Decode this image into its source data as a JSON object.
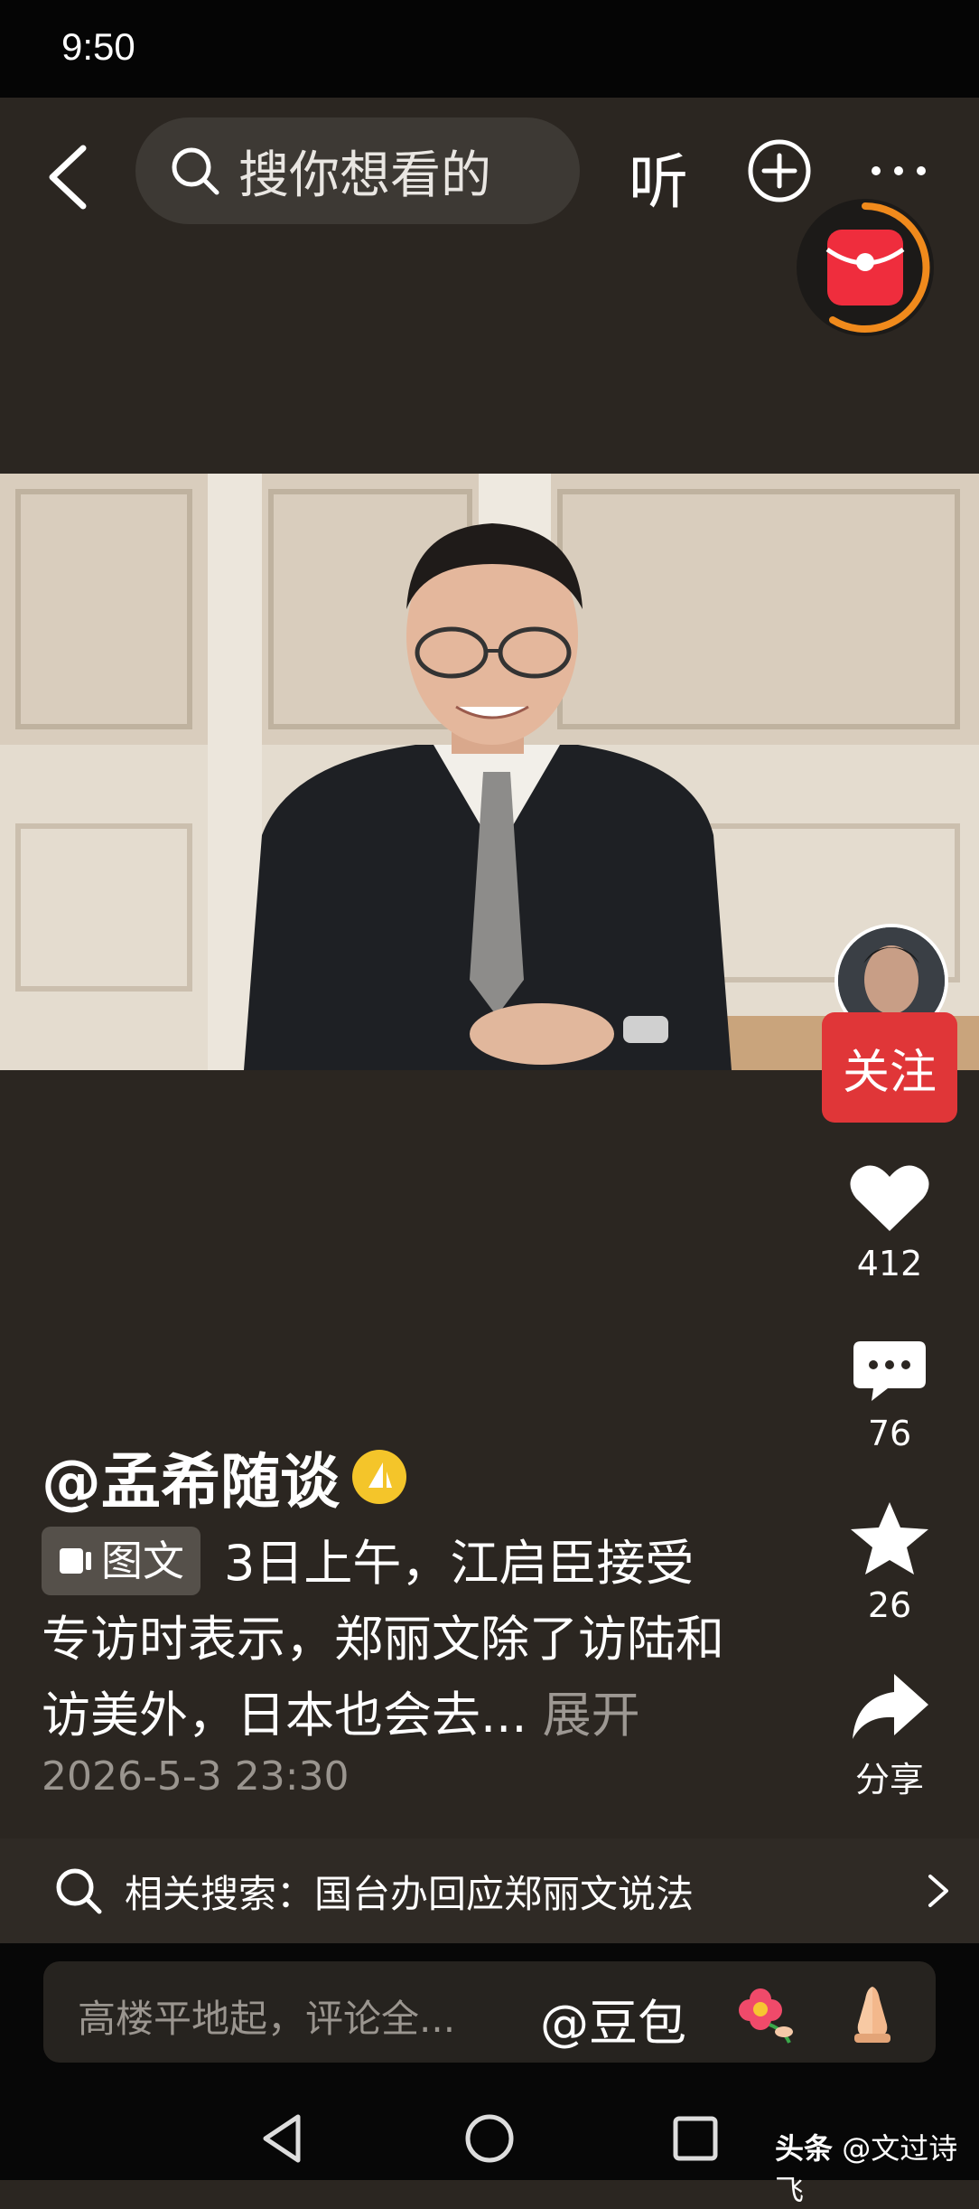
{
  "status_bar": {
    "time": "9:50"
  },
  "top_bar": {
    "search_placeholder": "搜你想看的",
    "listen_label": "听"
  },
  "side_actions": {
    "follow_label": "关注",
    "like_count": "412",
    "comment_count": "76",
    "favorite_count": "26",
    "share_label": "分享"
  },
  "post": {
    "author": "@孟希随谈",
    "type_tag": "图文",
    "description_line1": "3日上午，江启臣接受",
    "description_line2": "专访时表示，郑丽文除了访陆和",
    "description_line3": "访美外，日本也会去...",
    "expand_label": "展开",
    "date": "2026-5-3 23:30"
  },
  "related_search": {
    "label": "相关搜索：国台办回应郑丽文说法"
  },
  "comment_bar": {
    "placeholder": "高楼平地起，评论全...",
    "mention": "@豆包"
  },
  "watermark": {
    "brand": "头条",
    "handle": "@文过诗飞"
  },
  "colors": {
    "background": "#2b2621",
    "follow": "#e03638",
    "redpacket_ring": "#f08a1c"
  }
}
